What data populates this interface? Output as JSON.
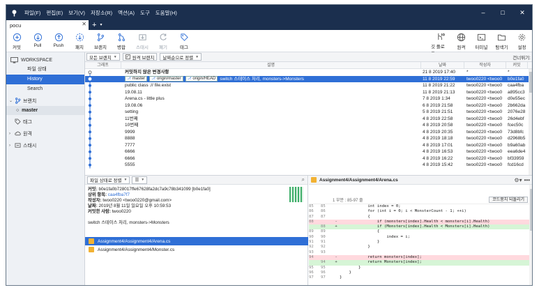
{
  "app": {
    "menu": [
      "파일(F)",
      "편집(E)",
      "보기(V)",
      "저장소(R)",
      "액션(A)",
      "도구",
      "도움말(H)"
    ],
    "window_controls": [
      "–",
      "□",
      "✕"
    ]
  },
  "tabs": [
    {
      "label": "pocu",
      "close": "✕"
    }
  ],
  "tab_add": "+",
  "tab_dropdown": "▾",
  "toolbar": {
    "left": [
      {
        "label": "커밋",
        "icon": "plus-circle-icon"
      },
      {
        "label": "Pull",
        "icon": "arrow-down-circle-icon"
      },
      {
        "label": "Push",
        "icon": "arrow-up-circle-icon"
      },
      {
        "label": "패치",
        "icon": "arrow-down-dashed-icon"
      },
      {
        "label": "브랜치",
        "icon": "branch-icon"
      },
      {
        "label": "병합",
        "icon": "merge-icon"
      },
      {
        "label": "스태시",
        "icon": "stash-icon",
        "disabled": true
      },
      {
        "label": "폐기",
        "icon": "discard-icon",
        "disabled": true
      },
      {
        "label": "태그",
        "icon": "tag-icon"
      }
    ],
    "right": [
      {
        "label": "깃 플로우...",
        "icon": "git-flow-icon"
      },
      {
        "label": "원격",
        "icon": "globe-icon"
      },
      {
        "label": "터미널",
        "icon": "terminal-icon"
      },
      {
        "label": "탐색기",
        "icon": "folder-icon"
      },
      {
        "label": "설정",
        "icon": "gear-icon"
      }
    ]
  },
  "sidebar": {
    "workspace": "WORKSPACE",
    "workspace_items": [
      {
        "label": "파일 상태",
        "active": false
      },
      {
        "label": "History",
        "active": true
      },
      {
        "label": "Search",
        "active": false
      }
    ],
    "branches_label": "브랜치",
    "branches": [
      "master"
    ],
    "tags_label": "태그",
    "remotes_label": "원격",
    "stashes_label": "스태시"
  },
  "filter": {
    "branches_dropdown": "모든 브랜치",
    "remote_branches_label": "원격 브랜치",
    "remote_branches_checked": true,
    "sort_dropdown": "날짜순으로 정렬",
    "skip_label": "건너뛰기:"
  },
  "history": {
    "columns": {
      "graph": "그래프",
      "desc": "설명",
      "date": "날짜",
      "author": "작성자",
      "commit": "커밋"
    },
    "rows": [
      {
        "desc": "커밋하지 않은 변경사항",
        "date": "21 8 2019 17:40",
        "author": "*",
        "commit": "*",
        "bold": true
      },
      {
        "refs": [
          "master",
          "origin/master",
          "origin/HEAD"
        ],
        "desc": "switch 스테이스 처리, monsters->Monsters",
        "date": "11 8 2019 22:59",
        "author": "twoo0220 <twoo0",
        "commit": "b0e1fa0",
        "selected": true
      },
      {
        "desc": "public class :// file.exist",
        "date": "11 8 2019 21:22",
        "author": "twoo0220 <twoo0",
        "commit": "caa4fba"
      },
      {
        "desc": "19.08.11",
        "date": "11 8 2019 21:13",
        "author": "twoo0220 <twoo0",
        "commit": "a895cc3"
      },
      {
        "desc": "Arena.cs - little plus",
        "date": "7 8 2019 1:34",
        "author": "twoo0220 <twoo0",
        "commit": "d0e55ec"
      },
      {
        "desc": "19.08.06",
        "date": "6 8 2019 21:58",
        "author": "twoo0220 <twoo0",
        "commit": "2b662da"
      },
      {
        "desc": "setting",
        "date": "5 8 2019 21:51",
        "author": "twoo0220 <twoo0",
        "commit": "2076e28"
      },
      {
        "desc": "11번째",
        "date": "4 8 2019 22:58",
        "author": "twoo0220 <twoo0",
        "commit": "26d4ebf"
      },
      {
        "desc": "10번째",
        "date": "4 8 2019 20:58",
        "author": "twoo0220 <twoo0",
        "commit": "fcec50c"
      },
      {
        "desc": "9999",
        "date": "4 8 2019 20:35",
        "author": "twoo0220 <twoo0",
        "commit": "73d8bfc"
      },
      {
        "desc": "8888",
        "date": "4 8 2019 18:18",
        "author": "twoo0220 <twoo0",
        "commit": "d2968b5"
      },
      {
        "desc": "7777",
        "date": "4 8 2019 17:01",
        "author": "twoo0220 <twoo0",
        "commit": "b9a60ab"
      },
      {
        "desc": "6666",
        "date": "4 8 2019 16:53",
        "author": "twoo0220 <twoo0",
        "commit": "eea6de4"
      },
      {
        "desc": "6666",
        "date": "4 8 2019 16:22",
        "author": "twoo0220 <twoo0",
        "commit": "bf33959"
      },
      {
        "desc": "5555",
        "date": "4 8 2019 15:42",
        "author": "twoo0220 <twoo0",
        "commit": "fcd16cd"
      }
    ]
  },
  "details": {
    "sort_dropdown": "파일 상태로 정렬",
    "view_dropdown": "☰",
    "commit_label": "커밋:",
    "commit_value": "b0e1fa0b728017ffe67628fa2dc7a9c78b341099 [b0e1fa0]",
    "parent_label": "상위 항목:",
    "parent_value": "caa4fba7f7",
    "author_label": "작성자:",
    "author_value": "twoo0220 <twoo0220@gmail.com>",
    "date_label": "날짜:",
    "date_value": "2019년 8월 11일 일요일 오후 10:59:53",
    "committer_label": "커밋한 사람:",
    "committer_value": "twoo0220",
    "message": "switch 스테이스 처리, monsters->Monsters",
    "files": [
      {
        "name": "Assignment4/Assignment4/Arena.cs",
        "selected": true
      },
      {
        "name": "Assignment4/Assignment4/Monster.cs",
        "selected": false
      }
    ]
  },
  "diff": {
    "file": "Assignment4/Assignment4/Arena.cs",
    "hunk": "1 부분 : 85-97 줄",
    "discard_label": "코드뭉치 되돌리기",
    "lines": [
      {
        "o": "85",
        "n": "85",
        "t": "ctx",
        "code": "            int index = 0;"
      },
      {
        "o": "86",
        "n": "86",
        "t": "ctx",
        "code": "            for (int i = 0; i < MonsterCount - 1; ++i)"
      },
      {
        "o": "87",
        "n": "87",
        "t": "ctx",
        "code": "            {"
      },
      {
        "o": "88",
        "n": "",
        "t": "rem",
        "code": "                if (monsters[index].Health < monsters[i].Health)"
      },
      {
        "o": "",
        "n": "88",
        "t": "add",
        "code": "                if (Monsters[index].Health < Monsters[i].Health)"
      },
      {
        "o": "89",
        "n": "89",
        "t": "ctx",
        "code": "                {"
      },
      {
        "o": "90",
        "n": "90",
        "t": "ctx",
        "code": "                    index = i;"
      },
      {
        "o": "91",
        "n": "91",
        "t": "ctx",
        "code": "                }"
      },
      {
        "o": "92",
        "n": "92",
        "t": "ctx",
        "code": "            }"
      },
      {
        "o": "93",
        "n": "93",
        "t": "ctx",
        "code": ""
      },
      {
        "o": "94",
        "n": "",
        "t": "rem",
        "code": "            return monsters[index];"
      },
      {
        "o": "",
        "n": "94",
        "t": "add",
        "code": "            return Monsters[index];"
      },
      {
        "o": "95",
        "n": "95",
        "t": "ctx",
        "code": "        }"
      },
      {
        "o": "96",
        "n": "96",
        "t": "ctx",
        "code": "    }"
      },
      {
        "o": "97",
        "n": "97",
        "t": "ctx",
        "code": "}"
      }
    ]
  },
  "colors": {
    "titlebar": "#1b2f4e",
    "accent": "#2f6fd6",
    "diff_removed": "#ffd9de",
    "diff_added": "#d6f5d6"
  }
}
